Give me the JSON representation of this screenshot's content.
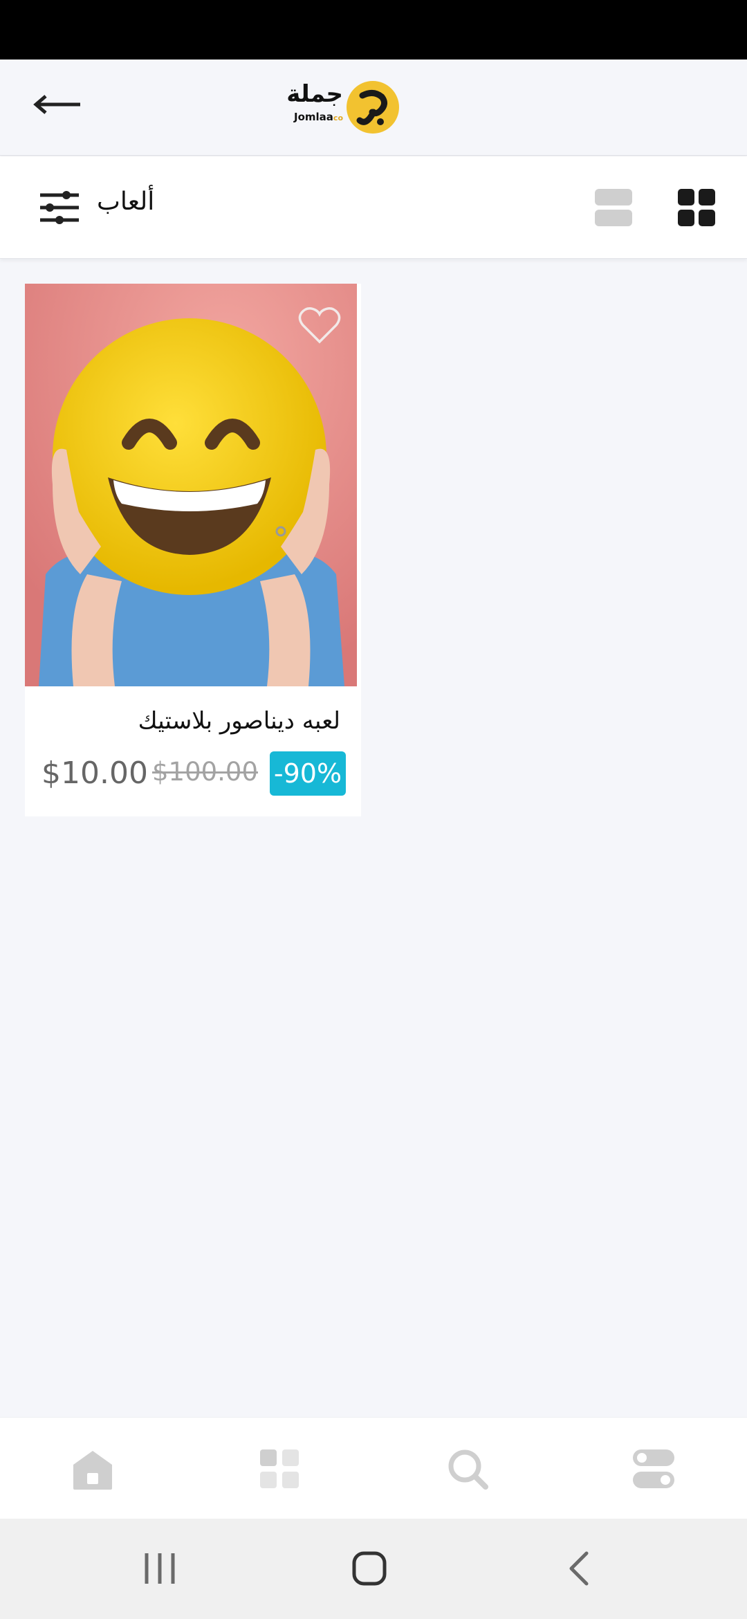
{
  "app": {
    "logo_arabic": "جملة",
    "logo_latin": "Jomlaa",
    "logo_suffix": "co"
  },
  "toolbar": {
    "category_title": "ألعاب"
  },
  "products": [
    {
      "name": "لعبه ديناصور بلاستيك",
      "price": "$10.00",
      "old_price": "$100.00",
      "discount": "-90%",
      "favorited": false
    }
  ],
  "icons": {
    "back": "arrow-left-icon",
    "filter": "sliders-icon",
    "view_list": "list-view-icon",
    "view_grid": "grid-view-icon",
    "favorite": "heart-outline-icon",
    "nav": [
      "home-icon",
      "categories-icon",
      "search-icon",
      "settings-toggle-icon"
    ],
    "system": [
      "recents-icon",
      "home-circle-icon",
      "system-back-icon"
    ]
  },
  "colors": {
    "accent_badge": "#17b8d6",
    "logo_yellow": "#f2c230",
    "background": "#f5f6fa",
    "nav_icon": "#cfcfcf"
  }
}
